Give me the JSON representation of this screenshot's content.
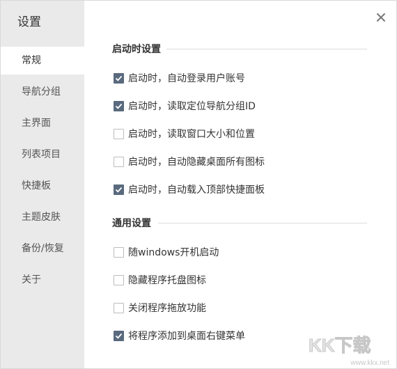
{
  "sidebar": {
    "title": "设置",
    "items": [
      {
        "label": "常规",
        "active": true
      },
      {
        "label": "导航分组",
        "active": false
      },
      {
        "label": "主界面",
        "active": false
      },
      {
        "label": "列表项目",
        "active": false
      },
      {
        "label": "快捷板",
        "active": false
      },
      {
        "label": "主题皮肤",
        "active": false
      },
      {
        "label": "备份/恢复",
        "active": false
      },
      {
        "label": "关于",
        "active": false
      }
    ]
  },
  "close_icon": "close-icon",
  "sections": [
    {
      "title": "启动时设置",
      "options": [
        {
          "label": "启动时，自动登录用户账号",
          "checked": true
        },
        {
          "label": "启动时，读取定位导航分组ID",
          "checked": true
        },
        {
          "label": "启动时，读取窗口大小和位置",
          "checked": false
        },
        {
          "label": "启动时，自动隐藏桌面所有图标",
          "checked": false
        },
        {
          "label": "启动时，自动载入顶部快捷面板",
          "checked": true
        }
      ]
    },
    {
      "title": "通用设置",
      "options": [
        {
          "label": "随windows开机启动",
          "checked": false
        },
        {
          "label": "隐藏程序托盘图标",
          "checked": false
        },
        {
          "label": "关闭程序拖放功能",
          "checked": false
        },
        {
          "label": "将程序添加到桌面右键菜单",
          "checked": true
        }
      ]
    }
  ],
  "watermark": {
    "logo_text": "KK下载",
    "url": "www.kkx.net"
  },
  "colors": {
    "sidebar_bg": "#eaeaea",
    "checkbox_checked": "#5a6a7e",
    "divider": "#dddddd"
  }
}
